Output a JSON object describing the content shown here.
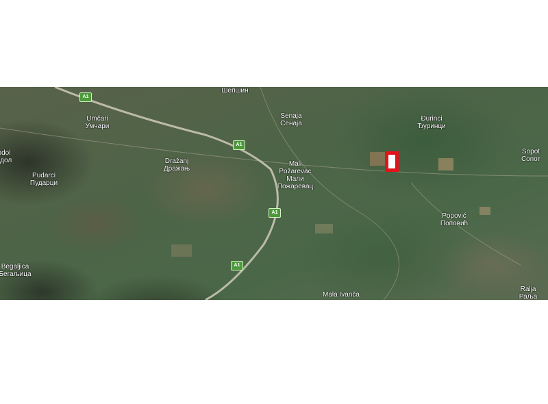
{
  "map": {
    "places": [
      {
        "id": "sepsin",
        "lines": [
          "Шепшин"
        ]
      },
      {
        "id": "umcari",
        "lines": [
          "Umčari",
          "Умчари"
        ]
      },
      {
        "id": "senaja",
        "lines": [
          "Senaja",
          "Сенаја"
        ]
      },
      {
        "id": "durinci",
        "lines": [
          "Đurinci",
          "Ђуринци"
        ]
      },
      {
        "id": "sopot",
        "lines": [
          "Sopot",
          "Сопот"
        ]
      },
      {
        "id": "drazanj",
        "lines": [
          "Dražanj",
          "Дражањ"
        ]
      },
      {
        "id": "mali-pozarevac",
        "lines": [
          "Mali",
          "Požarevac",
          "Мали",
          "Пожаревац"
        ]
      },
      {
        "id": "dol",
        "lines": [
          "odol",
          "одол"
        ]
      },
      {
        "id": "pudarci",
        "lines": [
          "Pudarci",
          "Пударци"
        ]
      },
      {
        "id": "popovic",
        "lines": [
          "Popović",
          "Поповић"
        ]
      },
      {
        "id": "begaljica",
        "lines": [
          "Begaljica",
          "Бегаљица"
        ]
      },
      {
        "id": "mala-ivanca",
        "lines": [
          "Mala Ivanča"
        ]
      },
      {
        "id": "ralja",
        "lines": [
          "Ralja",
          "Раља"
        ]
      }
    ],
    "road_shields": [
      {
        "id": "a1-1",
        "label": "A1"
      },
      {
        "id": "a1-2",
        "label": "A1"
      },
      {
        "id": "a1-3",
        "label": "A1"
      },
      {
        "id": "a1-4",
        "label": "A1"
      }
    ],
    "marker_color": "#e3121b"
  }
}
